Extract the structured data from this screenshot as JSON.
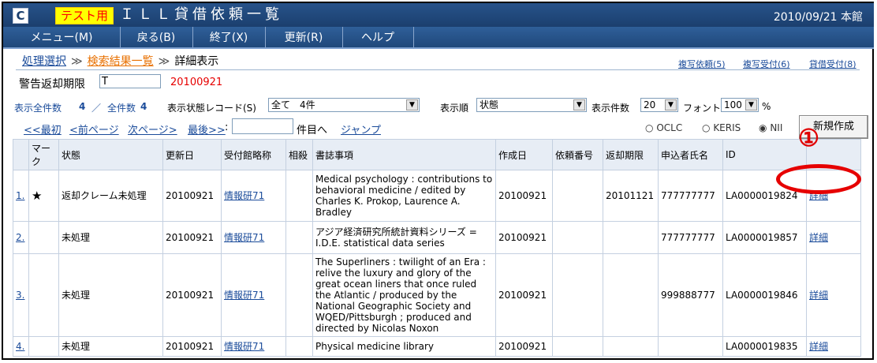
{
  "titlebar": {
    "logo": "C",
    "test_badge": "テスト用",
    "title": "ＩＬＬ貸借依頼一覧",
    "date_library": "2010/09/21 本館"
  },
  "menu": [
    {
      "label": "メニュー(M)"
    },
    {
      "label": "戻る(B)"
    },
    {
      "label": "終了(X)"
    },
    {
      "label": "更新(R)"
    },
    {
      "label": "ヘルプ"
    }
  ],
  "breadcrumb": {
    "item1": "処理選択",
    "item2": "検索結果一覧",
    "sep": "≫",
    "current": "詳細表示"
  },
  "top_links": [
    "複写依頼(5)",
    "複写受付(6)",
    "貸借受付(8)"
  ],
  "warning": {
    "label": "警告返却期限",
    "input_value": "T",
    "date": "20100921"
  },
  "counts": {
    "display_total_label": "表示全件数",
    "display_total": "4",
    "slash": "／",
    "all_total_label": "全件数",
    "all_total": "4",
    "status_label": "表示状態レコード(S)",
    "status_select": "全て　4件",
    "order_label": "表示順",
    "order_select": "状態",
    "perpage_label": "表示件数",
    "perpage_select": "20",
    "font_label": "フォント",
    "font_select": "100",
    "percent": "%"
  },
  "paging": {
    "first": "<<最初",
    "prev": "<前ページ",
    "next": "次ページ>",
    "last": "最後>>",
    "colon": ":",
    "goto_label": "件目へ",
    "jump": "ジャンプ"
  },
  "sources": {
    "oclc": "OCLC",
    "keris": "KERIS",
    "nii": "NII",
    "selected": "NII"
  },
  "new_button": "新規作成",
  "table": {
    "headers": [
      "",
      "マーク",
      "状態",
      "更新日",
      "受付館略称",
      "相殺",
      "書誌事項",
      "作成日",
      "依頼番号",
      "返却期限",
      "申込者氏名",
      "ID",
      ""
    ],
    "rows": [
      {
        "no": "1.",
        "mark": "★",
        "status": "返却クレーム未処理",
        "updated": "20100921",
        "library": "情報研71",
        "offset": "",
        "biblio": "Medical psychology : contributions to behavioral medicine / edited by Charles K. Prokop, Laurence A. Bradley",
        "created": "20100921",
        "request_no": "",
        "due": "20101121",
        "applicant": "777777777",
        "id": "LA0000019824",
        "detail": "詳細"
      },
      {
        "no": "2.",
        "mark": "",
        "status": "未処理",
        "updated": "20100921",
        "library": "情報研71",
        "offset": "",
        "biblio": "アジア経済研究所統計資料シリーズ = I.D.E. statistical data series",
        "created": "20100921",
        "request_no": "",
        "due": "",
        "applicant": "777777777",
        "id": "LA0000019857",
        "detail": "詳細"
      },
      {
        "no": "3.",
        "mark": "",
        "status": "未処理",
        "updated": "20100921",
        "library": "情報研71",
        "offset": "",
        "biblio": "The Superliners : twilight of an Era : relive the luxury and glory of the great ocean liners that once ruled the Atlantic / produced by the National Geographic Society and WQED/Pittsburgh ; produced and directed by Nicolas Noxon",
        "created": "20100921",
        "request_no": "",
        "due": "",
        "applicant": "999888777",
        "id": "LA0000019846",
        "detail": "詳細"
      },
      {
        "no": "4.",
        "mark": "",
        "status": "未処理",
        "updated": "20100921",
        "library": "情報研71",
        "offset": "",
        "biblio": "Physical medicine library",
        "created": "20100921",
        "request_no": "",
        "due": "",
        "applicant": "",
        "id": "LA0000019835",
        "detail": "詳細"
      }
    ]
  },
  "annotation": {
    "number": "①",
    "color": "#e60000"
  }
}
